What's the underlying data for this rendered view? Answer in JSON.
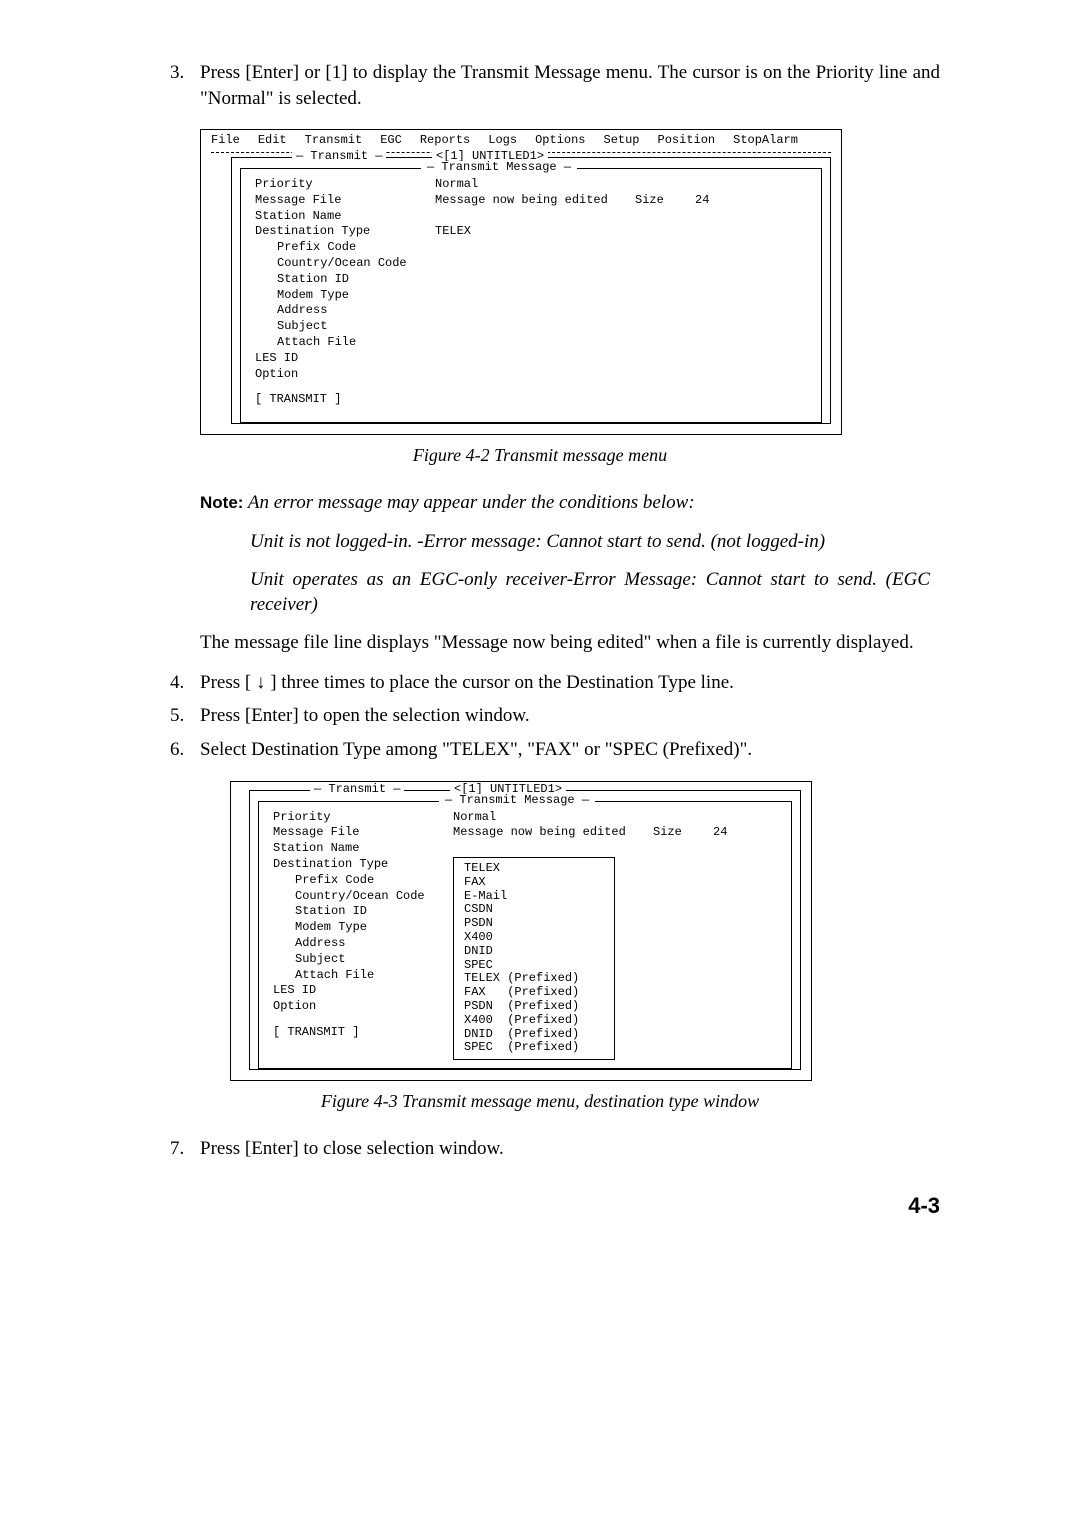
{
  "step3": {
    "num": "3.",
    "text": "Press [Enter] or [1] to display the Transmit Message menu. The cursor is on the Priority line and \"Normal\" is selected."
  },
  "fig1": {
    "menubar": [
      "File",
      "Edit",
      "Transmit",
      "EGC",
      "Reports",
      "Logs",
      "Options",
      "Setup",
      "Position",
      "StopAlarm"
    ],
    "transmit_label": "Transmit",
    "untitled": "<[1] UNTITLED1>",
    "transmit_msg": "Transmit Message",
    "priority": "Priority",
    "normal": "Normal",
    "msgfile": "Message File",
    "msgnow": "Message now being edited",
    "size_label": "Size",
    "size_val": "24",
    "station_name": "Station Name",
    "dest_type": "Destination Type",
    "telex": "TELEX",
    "prefix": "Prefix Code",
    "country": "Country/Ocean Code",
    "station_id": "Station ID",
    "modem": "Modem Type",
    "address": "Address",
    "subject": "Subject",
    "attach": "Attach File",
    "les": "LES ID",
    "option": "Option",
    "transmit_btn": "[ TRANSMIT ]"
  },
  "caption1": "Figure 4-2 Transmit message menu",
  "note_label": "Note:",
  "note_text": " An error message may appear under the conditions below:",
  "note_sub1": "Unit is not logged-in. -Error message: Cannot start to send. (not logged-in)",
  "note_sub2": "Unit operates as an EGC-only receiver-Error Message: Cannot start to send. (EGC receiver)",
  "para1": "The message file line displays \"Message now being edited\" when a file is currently displayed.",
  "step4": {
    "num": "4.",
    "text": "Press [ ↓ ] three times to place the cursor on the Destination Type line."
  },
  "step5": {
    "num": "5.",
    "text": "Press [Enter] to open the selection window."
  },
  "step6": {
    "num": "6.",
    "text": "Select Destination Type among \"TELEX\", \"FAX\" or \"SPEC (Prefixed)\"."
  },
  "fig2": {
    "transmit_label": "Transmit",
    "untitled": "<[1] UNTITLED1>",
    "transmit_msg": "Transmit Message",
    "priority": "Priority",
    "normal": "Normal",
    "msgfile": "Message File",
    "msgnow": "Message now being edited",
    "size_label": "Size",
    "size_val": "24",
    "station_name": "Station Name",
    "dest_type": "Destination Type",
    "prefix": "Prefix Code",
    "country": "Country/Ocean Code",
    "station_id": "Station ID",
    "modem": "Modem Type",
    "address": "Address",
    "subject": "Subject",
    "attach": "Attach File",
    "les": "LES ID",
    "option": "Option",
    "transmit_btn": "[ TRANSMIT ]",
    "options": [
      "TELEX",
      "FAX",
      "E-Mail",
      "CSDN",
      "PSDN",
      "X400",
      "DNID",
      "SPEC",
      "TELEX (Prefixed)",
      "FAX   (Prefixed)",
      "PSDN  (Prefixed)",
      "X400  (Prefixed)",
      "DNID  (Prefixed)",
      "SPEC  (Prefixed)"
    ]
  },
  "caption2": "Figure 4-3 Transmit message menu, destination type window",
  "step7": {
    "num": "7.",
    "text": "Press [Enter] to close selection window."
  },
  "page_num": "4-3"
}
